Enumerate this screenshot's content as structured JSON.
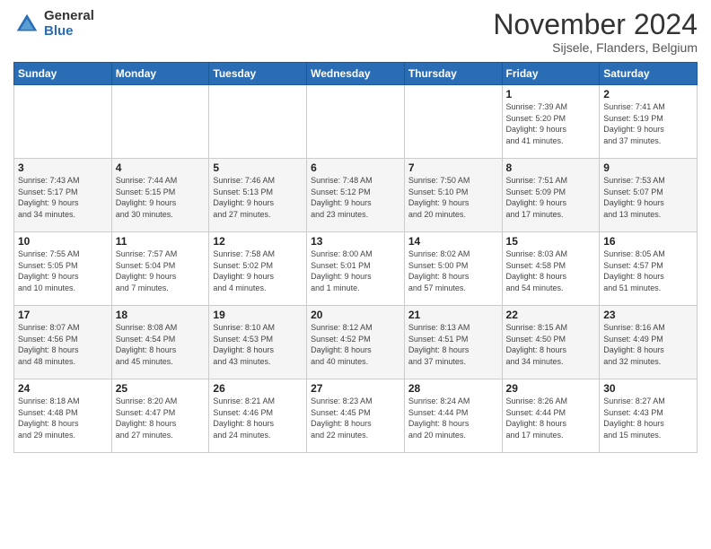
{
  "logo": {
    "general": "General",
    "blue": "Blue"
  },
  "title": "November 2024",
  "subtitle": "Sijsele, Flanders, Belgium",
  "headers": [
    "Sunday",
    "Monday",
    "Tuesday",
    "Wednesday",
    "Thursday",
    "Friday",
    "Saturday"
  ],
  "weeks": [
    [
      {
        "day": "",
        "detail": ""
      },
      {
        "day": "",
        "detail": ""
      },
      {
        "day": "",
        "detail": ""
      },
      {
        "day": "",
        "detail": ""
      },
      {
        "day": "",
        "detail": ""
      },
      {
        "day": "1",
        "detail": "Sunrise: 7:39 AM\nSunset: 5:20 PM\nDaylight: 9 hours\nand 41 minutes."
      },
      {
        "day": "2",
        "detail": "Sunrise: 7:41 AM\nSunset: 5:19 PM\nDaylight: 9 hours\nand 37 minutes."
      }
    ],
    [
      {
        "day": "3",
        "detail": "Sunrise: 7:43 AM\nSunset: 5:17 PM\nDaylight: 9 hours\nand 34 minutes."
      },
      {
        "day": "4",
        "detail": "Sunrise: 7:44 AM\nSunset: 5:15 PM\nDaylight: 9 hours\nand 30 minutes."
      },
      {
        "day": "5",
        "detail": "Sunrise: 7:46 AM\nSunset: 5:13 PM\nDaylight: 9 hours\nand 27 minutes."
      },
      {
        "day": "6",
        "detail": "Sunrise: 7:48 AM\nSunset: 5:12 PM\nDaylight: 9 hours\nand 23 minutes."
      },
      {
        "day": "7",
        "detail": "Sunrise: 7:50 AM\nSunset: 5:10 PM\nDaylight: 9 hours\nand 20 minutes."
      },
      {
        "day": "8",
        "detail": "Sunrise: 7:51 AM\nSunset: 5:09 PM\nDaylight: 9 hours\nand 17 minutes."
      },
      {
        "day": "9",
        "detail": "Sunrise: 7:53 AM\nSunset: 5:07 PM\nDaylight: 9 hours\nand 13 minutes."
      }
    ],
    [
      {
        "day": "10",
        "detail": "Sunrise: 7:55 AM\nSunset: 5:05 PM\nDaylight: 9 hours\nand 10 minutes."
      },
      {
        "day": "11",
        "detail": "Sunrise: 7:57 AM\nSunset: 5:04 PM\nDaylight: 9 hours\nand 7 minutes."
      },
      {
        "day": "12",
        "detail": "Sunrise: 7:58 AM\nSunset: 5:02 PM\nDaylight: 9 hours\nand 4 minutes."
      },
      {
        "day": "13",
        "detail": "Sunrise: 8:00 AM\nSunset: 5:01 PM\nDaylight: 9 hours\nand 1 minute."
      },
      {
        "day": "14",
        "detail": "Sunrise: 8:02 AM\nSunset: 5:00 PM\nDaylight: 8 hours\nand 57 minutes."
      },
      {
        "day": "15",
        "detail": "Sunrise: 8:03 AM\nSunset: 4:58 PM\nDaylight: 8 hours\nand 54 minutes."
      },
      {
        "day": "16",
        "detail": "Sunrise: 8:05 AM\nSunset: 4:57 PM\nDaylight: 8 hours\nand 51 minutes."
      }
    ],
    [
      {
        "day": "17",
        "detail": "Sunrise: 8:07 AM\nSunset: 4:56 PM\nDaylight: 8 hours\nand 48 minutes."
      },
      {
        "day": "18",
        "detail": "Sunrise: 8:08 AM\nSunset: 4:54 PM\nDaylight: 8 hours\nand 45 minutes."
      },
      {
        "day": "19",
        "detail": "Sunrise: 8:10 AM\nSunset: 4:53 PM\nDaylight: 8 hours\nand 43 minutes."
      },
      {
        "day": "20",
        "detail": "Sunrise: 8:12 AM\nSunset: 4:52 PM\nDaylight: 8 hours\nand 40 minutes."
      },
      {
        "day": "21",
        "detail": "Sunrise: 8:13 AM\nSunset: 4:51 PM\nDaylight: 8 hours\nand 37 minutes."
      },
      {
        "day": "22",
        "detail": "Sunrise: 8:15 AM\nSunset: 4:50 PM\nDaylight: 8 hours\nand 34 minutes."
      },
      {
        "day": "23",
        "detail": "Sunrise: 8:16 AM\nSunset: 4:49 PM\nDaylight: 8 hours\nand 32 minutes."
      }
    ],
    [
      {
        "day": "24",
        "detail": "Sunrise: 8:18 AM\nSunset: 4:48 PM\nDaylight: 8 hours\nand 29 minutes."
      },
      {
        "day": "25",
        "detail": "Sunrise: 8:20 AM\nSunset: 4:47 PM\nDaylight: 8 hours\nand 27 minutes."
      },
      {
        "day": "26",
        "detail": "Sunrise: 8:21 AM\nSunset: 4:46 PM\nDaylight: 8 hours\nand 24 minutes."
      },
      {
        "day": "27",
        "detail": "Sunrise: 8:23 AM\nSunset: 4:45 PM\nDaylight: 8 hours\nand 22 minutes."
      },
      {
        "day": "28",
        "detail": "Sunrise: 8:24 AM\nSunset: 4:44 PM\nDaylight: 8 hours\nand 20 minutes."
      },
      {
        "day": "29",
        "detail": "Sunrise: 8:26 AM\nSunset: 4:44 PM\nDaylight: 8 hours\nand 17 minutes."
      },
      {
        "day": "30",
        "detail": "Sunrise: 8:27 AM\nSunset: 4:43 PM\nDaylight: 8 hours\nand 15 minutes."
      }
    ]
  ]
}
